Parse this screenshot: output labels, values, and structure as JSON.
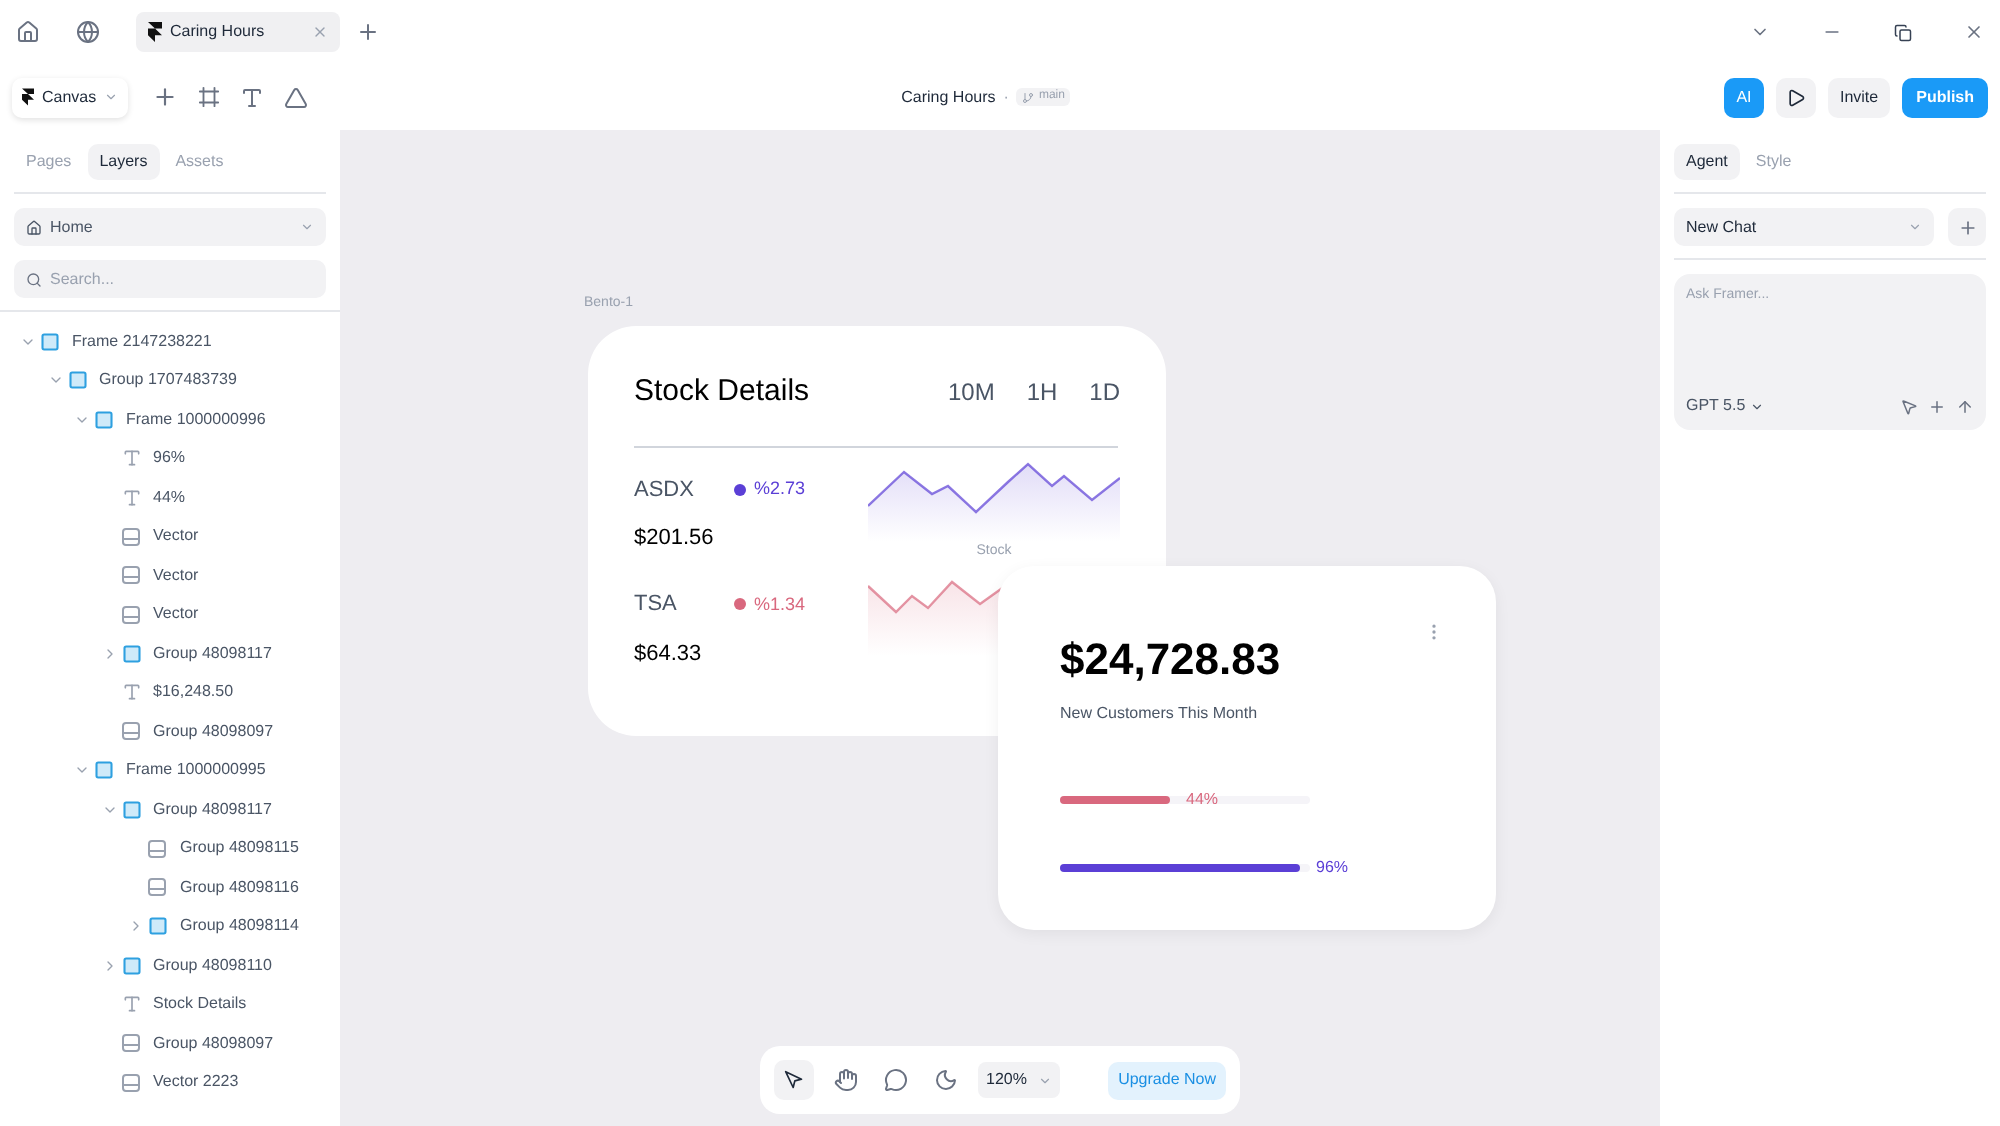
{
  "browser_tabs": [
    {
      "title": "Caring Hours",
      "selected": true
    }
  ],
  "toolbar": {
    "canvas_menu": "Canvas",
    "project": "Caring Hours",
    "separator": "·",
    "branch": "main",
    "ai": "AI",
    "invite": "Invite",
    "publish": "Publish"
  },
  "left_tabs": [
    {
      "label": "Pages",
      "selected": false
    },
    {
      "label": "Layers",
      "selected": true
    },
    {
      "label": "Assets",
      "selected": false
    }
  ],
  "page_select": "Home",
  "search": {
    "placeholder": "Search..."
  },
  "layers": [
    {
      "name": "Frame 2147238221",
      "kind": "frame",
      "expanded": true,
      "children": [
        {
          "name": "Group 1707483739",
          "kind": "frame",
          "expanded": true,
          "children": [
            {
              "name": "Frame 1000000996",
              "kind": "frame",
              "expanded": true,
              "children": [
                {
                  "name": "96%",
                  "kind": "text"
                },
                {
                  "name": "44%",
                  "kind": "text"
                },
                {
                  "name": "Vector",
                  "kind": "vector"
                },
                {
                  "name": "Vector",
                  "kind": "vector"
                },
                {
                  "name": "Vector",
                  "kind": "vector"
                },
                {
                  "name": "Group 48098117",
                  "kind": "frame",
                  "expanded": false
                },
                {
                  "name": "$16,248.50",
                  "kind": "text"
                },
                {
                  "name": "Group 48098097",
                  "kind": "vector"
                }
              ]
            },
            {
              "name": "Frame 1000000995",
              "kind": "frame",
              "expanded": true,
              "children": [
                {
                  "name": "Group 48098117",
                  "kind": "frame",
                  "expanded": true,
                  "children": [
                    {
                      "name": "Group 48098115",
                      "kind": "vector"
                    },
                    {
                      "name": "Group 48098116",
                      "kind": "vector"
                    },
                    {
                      "name": "Group 48098114",
                      "kind": "frame",
                      "expanded": false
                    }
                  ]
                },
                {
                  "name": "Group 48098110",
                  "kind": "frame",
                  "expanded": false
                },
                {
                  "name": "Stock Details",
                  "kind": "text"
                },
                {
                  "name": "Group 48098097",
                  "kind": "vector"
                },
                {
                  "name": "Vector 2223",
                  "kind": "vector"
                }
              ]
            }
          ]
        }
      ]
    }
  ],
  "canvas": {
    "frame_label": "Bento-1",
    "stock_card": {
      "title": "Stock Details",
      "ranges": [
        "10M",
        "1H",
        "1D"
      ],
      "chart_label": "Stock",
      "stocks": [
        {
          "ticker": "ASDX",
          "change": "%2.73",
          "price": "$201.56",
          "color": "#5b3fd6"
        },
        {
          "ticker": "TSA",
          "change": "%1.34",
          "price": "$64.33",
          "color": "#d9687e"
        }
      ]
    },
    "customers_card": {
      "amount": "$24,728.83",
      "caption": "New Customers This Month",
      "bars": [
        {
          "level": 0.44,
          "reading": "44%",
          "color": "#d9687e"
        },
        {
          "level": 0.96,
          "reading": "96%",
          "color": "#5b3fd6"
        }
      ]
    }
  },
  "bottom_bar": {
    "zoom": "120%",
    "upgrade": "Upgrade Now"
  },
  "right_tabs": [
    {
      "label": "Agent",
      "selected": true
    },
    {
      "label": "Style",
      "selected": false
    }
  ],
  "chat_select": "New Chat",
  "prompt": {
    "placeholder": "Ask Framer...",
    "model": "GPT 5.5"
  }
}
